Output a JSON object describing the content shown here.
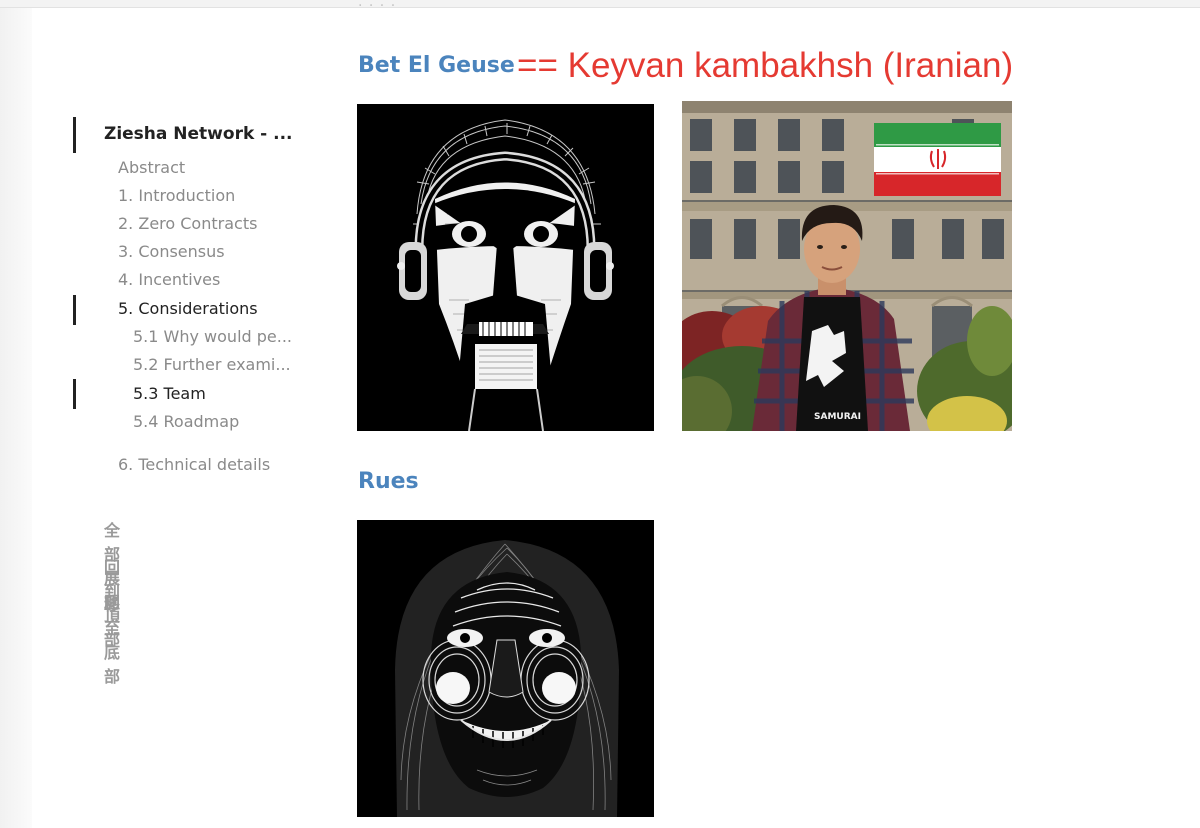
{
  "toc": {
    "title": "Ziesha Network - ...",
    "items": [
      {
        "label": "Abstract"
      },
      {
        "label": "1. Introduction"
      },
      {
        "label": "2. Zero Contracts"
      },
      {
        "label": "3. Consensus"
      },
      {
        "label": "4. Incentives"
      },
      {
        "label": "5. Considerations"
      },
      {
        "label": "5.1 Why would pe..."
      },
      {
        "label": "5.2 Further exami..."
      },
      {
        "label": "5.3 Team"
      },
      {
        "label": "5.4 Roadmap"
      },
      {
        "label": "6. Technical details"
      }
    ],
    "actions": [
      "全部展開",
      "回到頂部",
      "移至底部"
    ]
  },
  "team": {
    "member1": "Bet El Geuse",
    "annotation": "== Keyvan kambakhsh (Iranian)",
    "member2": "Rues",
    "shirt_text": "SAMURAI"
  },
  "colors": {
    "heading": "#4b84bd",
    "annotation": "#e53a32",
    "toc_text": "#8a8a8a",
    "toc_active": "#222222"
  }
}
